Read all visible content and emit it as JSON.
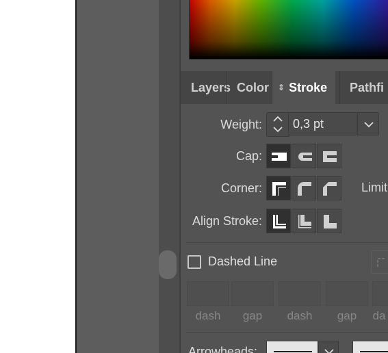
{
  "colors": {
    "panel_bg": "#535353",
    "tab_bar_bg": "#454545",
    "label_text": "#dcdcdc",
    "selected_button_bg": "#303030"
  },
  "tabs": [
    {
      "label": "Layers",
      "active": false
    },
    {
      "label": "Color",
      "active": false
    },
    {
      "label": "Stroke",
      "active": true,
      "icon": "collapse-arrows-icon"
    },
    {
      "label": "Pathfi",
      "active": false
    }
  ],
  "stroke": {
    "weight_label": "Weight:",
    "weight_value": "0,3 pt",
    "cap_label": "Cap:",
    "corner_label": "Corner:",
    "limit_label": "Limit",
    "align_label": "Align Stroke:",
    "cap_buttons": [
      "butt-cap-icon",
      "round-cap-icon",
      "projecting-cap-icon"
    ],
    "corner_buttons": [
      "miter-join-icon",
      "round-join-icon",
      "bevel-join-icon"
    ],
    "align_buttons": [
      "align-center-icon",
      "align-inside-icon",
      "align-outside-icon"
    ],
    "selected": {
      "cap": 0,
      "corner": 0,
      "align": 0
    }
  },
  "dashed": {
    "label": "Dashed Line",
    "checked": false,
    "field_labels": [
      "dash",
      "gap",
      "dash",
      "gap",
      "da"
    ]
  },
  "arrowheads": {
    "label": "Arrowheads:"
  }
}
